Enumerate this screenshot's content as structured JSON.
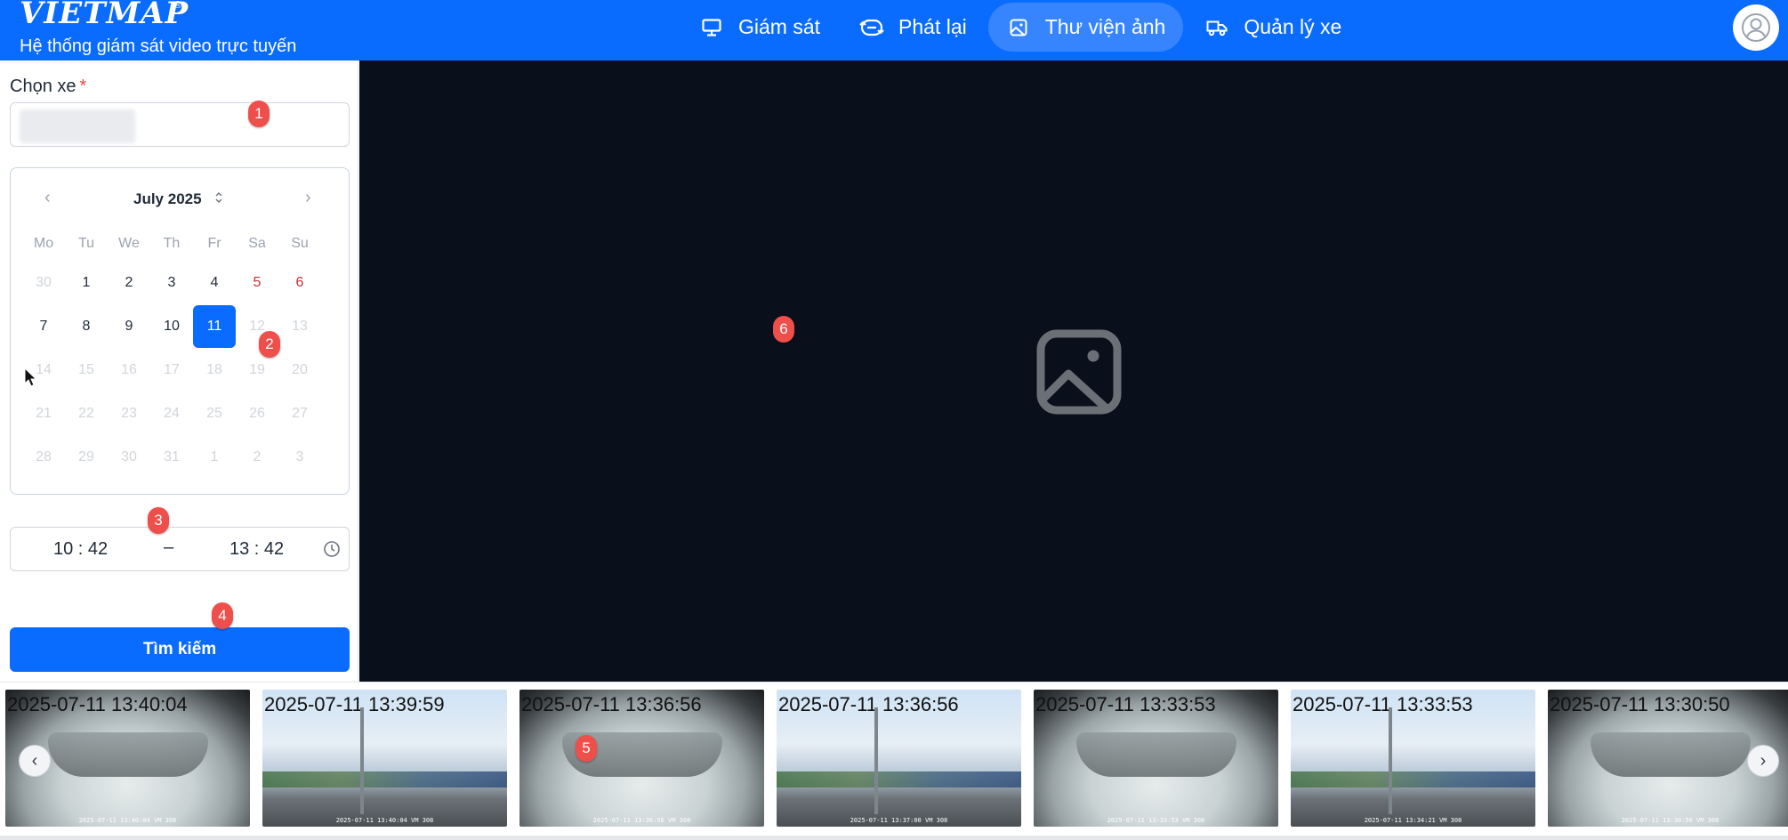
{
  "header": {
    "logo": "VIETMAP",
    "logo_reg": "®",
    "tagline": "Hệ thống giám sát video trực tuyến",
    "nav": [
      {
        "label": "Giám sát",
        "icon": "monitor-icon",
        "active": false
      },
      {
        "label": "Phát lại",
        "icon": "replay-icon",
        "active": false
      },
      {
        "label": "Thư viện ảnh",
        "icon": "image-icon",
        "active": true
      },
      {
        "label": "Quản lý xe",
        "icon": "truck-icon",
        "active": false
      }
    ],
    "avatar_icon": "user-icon"
  },
  "form": {
    "vehicle_label": "Chọn xe",
    "required_mark": "*",
    "vehicle_value": "",
    "calendar": {
      "title": "July 2025",
      "prev": "‹",
      "next": "›",
      "title_arrow": "⌃⌄",
      "weekdays": [
        "Mo",
        "Tu",
        "We",
        "Th",
        "Fr",
        "Sa",
        "Su"
      ],
      "weeks": [
        [
          "30",
          "1",
          "2",
          "3",
          "4",
          "5",
          "6"
        ],
        [
          "7",
          "8",
          "9",
          "10",
          "11",
          "12",
          "13"
        ],
        [
          "14",
          "15",
          "16",
          "17",
          "18",
          "19",
          "20"
        ],
        [
          "21",
          "22",
          "23",
          "24",
          "25",
          "26",
          "27"
        ],
        [
          "28",
          "29",
          "30",
          "31",
          "1",
          "2",
          "3"
        ]
      ],
      "selected": "11"
    },
    "time_start": "10 : 42",
    "time_dash": "–",
    "time_end": "13 : 42",
    "search_label": "Tìm kiếm"
  },
  "viewer": {
    "placeholder_icon": "image-placeholder-icon"
  },
  "thumbnails": [
    {
      "timestamp": "2025-07-11 13:40:04",
      "kind": "interior",
      "caption": "2025-07-11 13:40:04 VM 308"
    },
    {
      "timestamp": "2025-07-11 13:39:59",
      "kind": "road",
      "caption": "2025-07-11 13:40:04 VM 308"
    },
    {
      "timestamp": "2025-07-11 13:36:56",
      "kind": "interior",
      "caption": "2025-07-11 13:36:56 VM 308"
    },
    {
      "timestamp": "2025-07-11 13:36:56",
      "kind": "road",
      "caption": "2025-07-11 13:37:00 VM 308"
    },
    {
      "timestamp": "2025-07-11 13:33:53",
      "kind": "interior",
      "caption": "2025-07-11 13:33:53 VM 308"
    },
    {
      "timestamp": "2025-07-11 13:33:53",
      "kind": "road",
      "caption": "2025-07-11 13:34:21 VM 308"
    },
    {
      "timestamp": "2025-07-11 13:30:50",
      "kind": "interior",
      "caption": "2025-07-11 13:30:50 VM 308"
    }
  ],
  "strip_prev": "‹",
  "strip_next": "›",
  "markers": [
    "1",
    "2",
    "3",
    "4",
    "5",
    "6"
  ],
  "colors": {
    "primary": "#0a6bff",
    "viewer_bg": "#0a0f1c",
    "weekend": "#c53030",
    "marker": "#ef4f4a"
  }
}
